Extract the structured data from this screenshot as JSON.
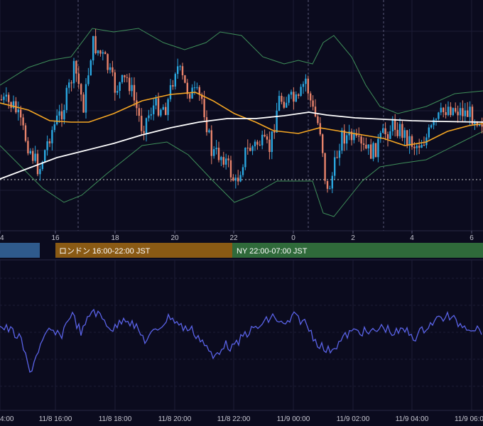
{
  "chart_data": [
    {
      "type": "candlestick",
      "panel": "price",
      "x_ticks": [
        "4",
        "16",
        "18",
        "20",
        "22",
        "0",
        "2",
        "4",
        "6"
      ],
      "up_color": "#2aa7e0",
      "down_color": "#e8836b",
      "overlays": [
        {
          "kind": "moving-average",
          "color": "#f5a623"
        },
        {
          "kind": "moving-average",
          "color": "#ffffff"
        },
        {
          "kind": "bollinger-bands",
          "color": "#3f8f5a"
        }
      ],
      "reference_line": "dotted horizontal",
      "grid": true,
      "session_markers": "dashed vertical lines"
    },
    {
      "type": "line",
      "panel": "oscillator",
      "color": "#5a63e8",
      "x_ticks": [
        "4:00",
        "11/8 16:00",
        "11/8 18:00",
        "11/8 20:00",
        "11/8 22:00",
        "11/9 00:00",
        "11/9 02:00",
        "11/9 04:00",
        "11/9 06:00"
      ],
      "grid": true
    }
  ],
  "sessions": [
    {
      "label": "",
      "color": "#2f5a8c"
    },
    {
      "label": "ロンドン 16:00-22:00 JST",
      "color": "#8a5a14"
    },
    {
      "label": "NY 22:00-07:00 JST",
      "color": "#2f6a3a"
    }
  ]
}
